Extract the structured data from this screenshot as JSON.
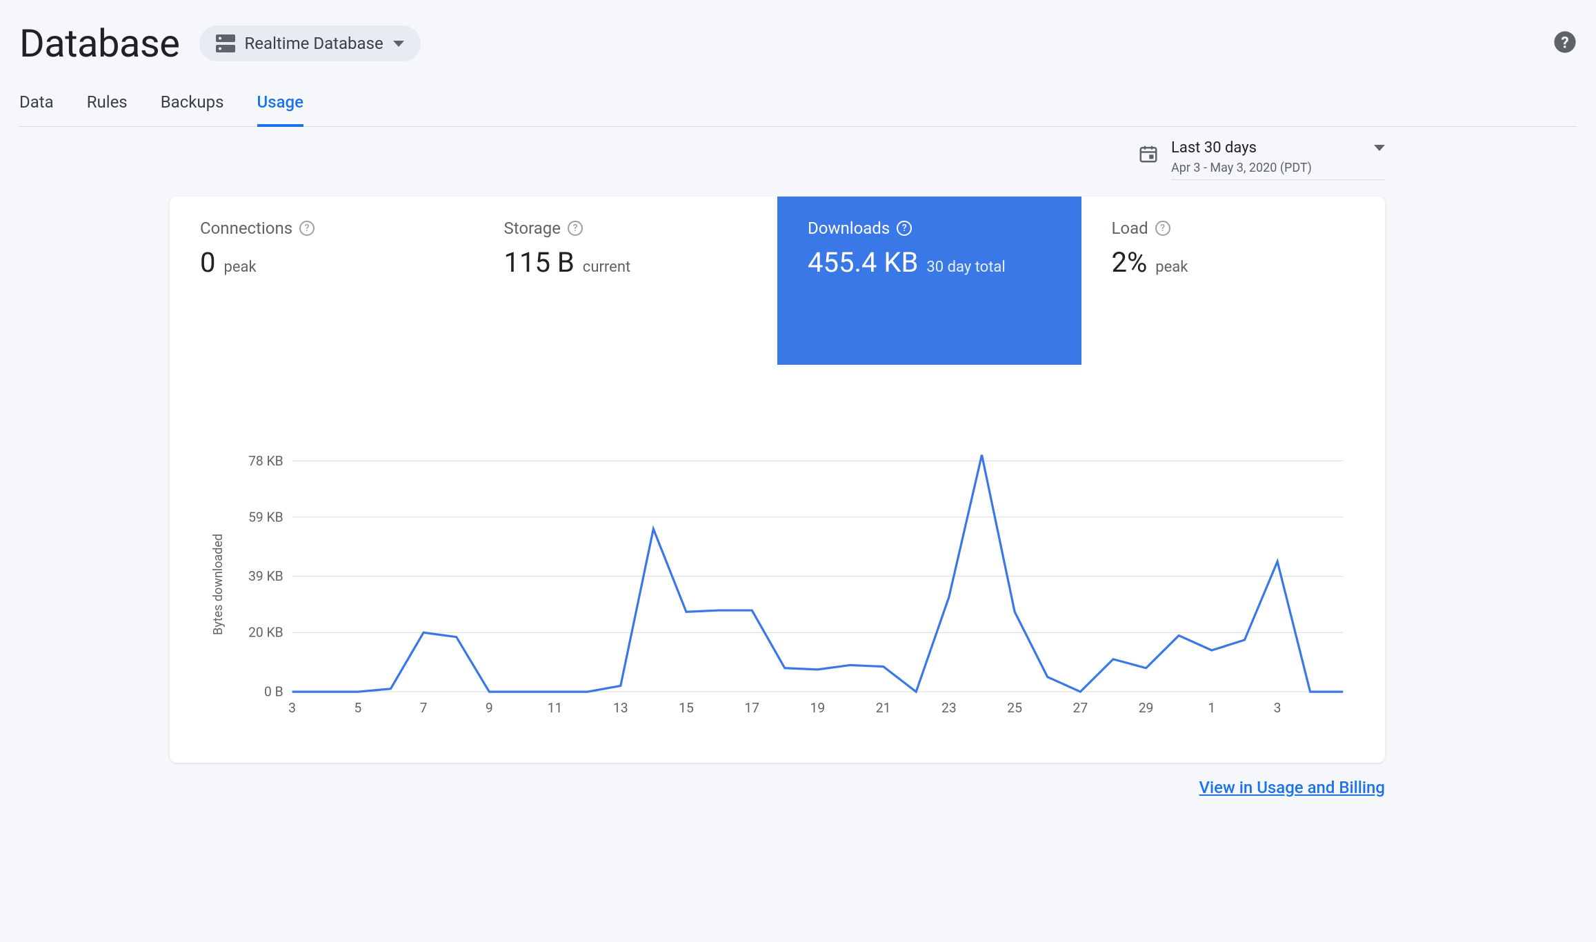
{
  "header": {
    "title": "Database",
    "db_selector_label": "Realtime Database"
  },
  "tabs": {
    "data": "Data",
    "rules": "Rules",
    "backups": "Backups",
    "usage": "Usage"
  },
  "date_picker": {
    "range_label": "Last 30 days",
    "detail": "Apr 3 - May 3, 2020 (PDT)"
  },
  "metrics": {
    "connections": {
      "label": "Connections",
      "value": "0",
      "sub": "peak"
    },
    "storage": {
      "label": "Storage",
      "value": "115 B",
      "sub": "current"
    },
    "downloads": {
      "label": "Downloads",
      "value": "455.4 KB",
      "sub": "30 day total"
    },
    "load": {
      "label": "Load",
      "value": "2%",
      "sub": "peak"
    }
  },
  "chart_data": {
    "type": "line",
    "title": "",
    "xlabel": "",
    "ylabel": "Bytes downloaded",
    "ylim": [
      0,
      80000
    ],
    "y_ticks": [
      "0 B",
      "20 KB",
      "39 KB",
      "59 KB",
      "78 KB"
    ],
    "x_ticks": [
      "3",
      "5",
      "7",
      "9",
      "11",
      "13",
      "15",
      "17",
      "19",
      "21",
      "23",
      "25",
      "27",
      "29",
      "1",
      "3"
    ],
    "categories": [
      3,
      4,
      5,
      6,
      7,
      8,
      9,
      10,
      11,
      12,
      13,
      14,
      15,
      16,
      17,
      18,
      19,
      20,
      21,
      22,
      23,
      24,
      25,
      26,
      27,
      28,
      29,
      30,
      1,
      2,
      3
    ],
    "values": [
      0,
      0,
      0,
      1000,
      20000,
      18500,
      0,
      0,
      0,
      0,
      2000,
      55000,
      27000,
      27500,
      27500,
      8000,
      7500,
      9000,
      8500,
      0,
      32000,
      80500,
      27000,
      5000,
      0,
      11000,
      8000,
      19000,
      14000,
      17500,
      44000,
      0,
      0
    ]
  },
  "footer_link": "View in Usage and Billing"
}
